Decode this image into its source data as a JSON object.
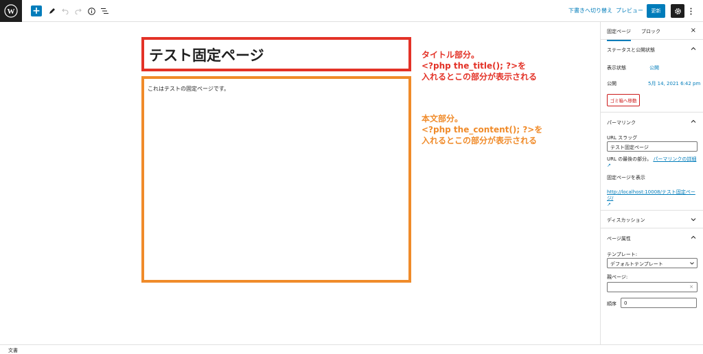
{
  "toolbar": {
    "add_label": "+",
    "draft_label": "下書きへ切り替え",
    "preview_label": "プレビュー",
    "update_label": "更新"
  },
  "editor": {
    "title": "テスト固定ページ",
    "content": "これはテストの固定ページです。"
  },
  "annotations": {
    "title_note": [
      "タイトル部分。",
      "<?php the_title(); ?>を",
      "入れるとこの部分が表示される"
    ],
    "content_note": [
      "本文部分。",
      "<?php the_content(); ?>を",
      "入れるとこの部分が表示される"
    ]
  },
  "sidebar": {
    "tabs": [
      "固定ページ",
      "ブロック"
    ],
    "close_label": "×",
    "status_panel": {
      "title": "ステータスと公開状態",
      "visibility_label": "表示状態",
      "visibility_value": "公開",
      "publish_label": "公開",
      "publish_value": "5月 14, 2021 6:42 pm",
      "trash_label": "ゴミ箱へ移動"
    },
    "permalink_panel": {
      "title": "パーマリンク",
      "slug_label": "URL スラッグ",
      "slug_value": "テスト固定ページ",
      "help_text": "URL の最後の部分。",
      "help_link": "パーマリンクの詳細",
      "view_label": "固定ページを表示",
      "view_url": "http://localhost:10008/テスト固定ページ/"
    },
    "discussion_panel": {
      "title": "ディスカッション"
    },
    "attributes_panel": {
      "title": "ページ属性",
      "template_label": "テンプレート:",
      "template_value": "デフォルトテンプレート",
      "parent_label": "親ページ:",
      "parent_clear": "×",
      "order_label": "順序",
      "order_value": "0"
    }
  },
  "footer": {
    "label": "文書"
  },
  "colors": {
    "accent": "#007cba",
    "title_box": "#e33227",
    "content_box": "#f08b2a",
    "trash": "#cc1818"
  }
}
